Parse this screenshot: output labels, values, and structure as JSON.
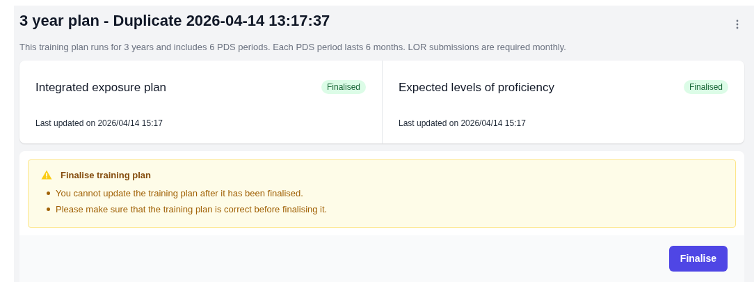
{
  "title": "3 year plan - Duplicate 2026-04-14 13:17:37",
  "description": "This training plan runs for 3 years and includes 6 PDS periods. Each PDS period lasts 6 months. LOR submissions are required monthly.",
  "plans": [
    {
      "title": "Integrated exposure plan",
      "status": "Finalised",
      "kind": "finalised",
      "updated": "Last updated on 2026/04/14 15:17"
    },
    {
      "title": "Expected levels of proficiency",
      "status": "Finalised",
      "kind": "finalised",
      "updated": "Last updated on 2026/04/14 15:17"
    }
  ],
  "warning": {
    "title": "Finalise training plan",
    "items": [
      "You cannot update the training plan after it has been finalised.",
      "Please make sure that the training plan is correct before finalising it."
    ]
  },
  "button": "Finalise"
}
